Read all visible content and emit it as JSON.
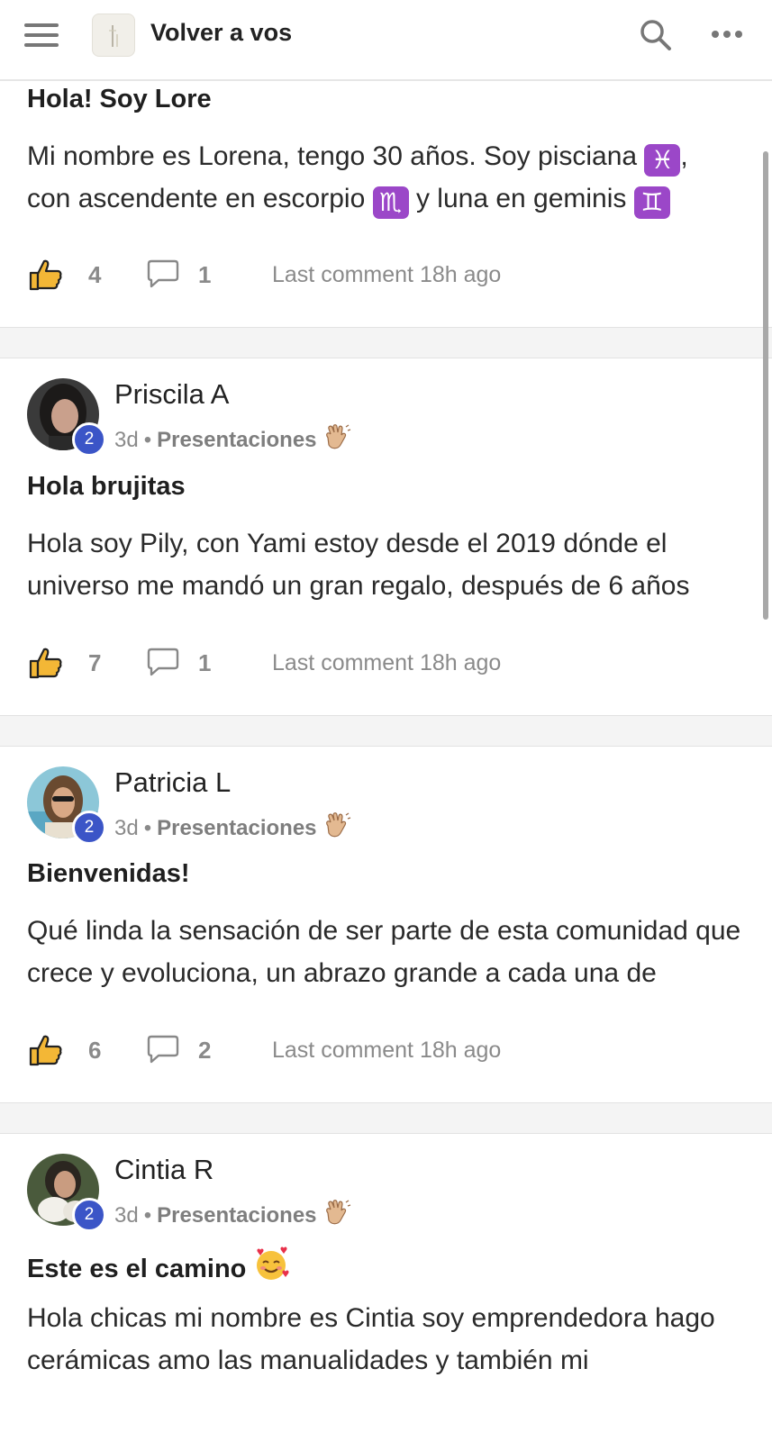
{
  "header": {
    "title": "Volver a vos",
    "menu_icon": "hamburger-menu-icon",
    "logo_icon": "wand-logo-icon",
    "search_icon": "search-icon",
    "more_icon": "more-horizontal-icon"
  },
  "colors": {
    "badge": "#3b55c7",
    "zodiac_bg": "#9b47c8",
    "like_icon": "#f3b736",
    "muted_text": "#8a8a8a"
  },
  "posts": [
    {
      "title": "Hola! Soy Lore",
      "body_parts": {
        "a": "Mi nombre es Lorena, tengo 30 años. Soy pisciana ",
        "pisces": "♓",
        "b": ",",
        "c": "con ascendente en escorpio ",
        "scorpio": "♏",
        "d": " y luna en geminis ",
        "gemini": "♊"
      },
      "likes": "4",
      "comments": "1",
      "last_comment": "Last comment 18h ago"
    },
    {
      "author": "Priscila A",
      "level": "2",
      "time": "3d",
      "dot": "•",
      "space": "Presentaciones",
      "space_emoji": "waving-hand-icon",
      "title": "Hola brujitas",
      "body": "Hola soy Pily, con Yami estoy desde el 2019 dónde el universo me mandó un gran regalo, después de 6 años",
      "likes": "7",
      "comments": "1",
      "last_comment": "Last comment 18h ago"
    },
    {
      "author": "Patricia L",
      "level": "2",
      "time": "3d",
      "dot": "•",
      "space": "Presentaciones",
      "space_emoji": "waving-hand-icon",
      "title": "Bienvenidas!",
      "body": "Qué linda la sensación de ser parte de esta comunidad que crece y evoluciona, un abrazo grande a cada una de",
      "likes": "6",
      "comments": "2",
      "last_comment": "Last comment 18h ago"
    },
    {
      "author": "Cintia R",
      "level": "2",
      "time": "3d",
      "dot": "•",
      "space": "Presentaciones",
      "space_emoji": "waving-hand-icon",
      "title": "Este es el camino",
      "title_emoji": "smiling-face-with-hearts-icon",
      "body": "Hola chicas mi nombre es Cintia soy emprendedora hago cerámicas amo las manualidades y también mi"
    }
  ]
}
